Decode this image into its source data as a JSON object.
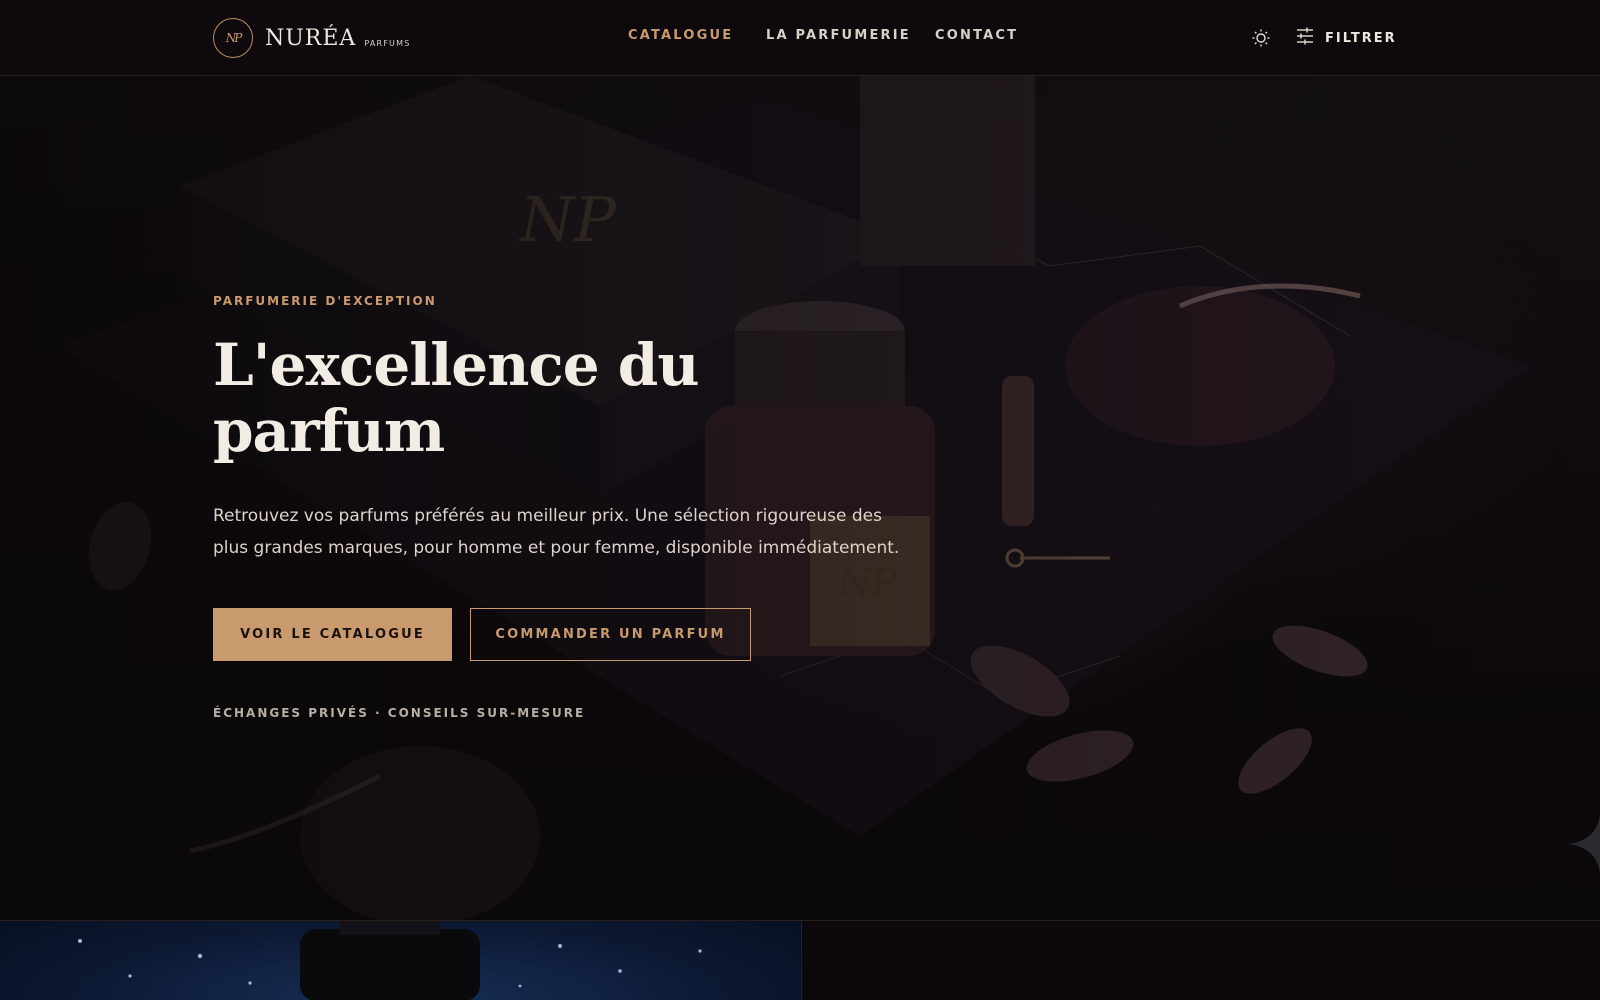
{
  "brand": {
    "monogram": "NP",
    "name": "NURÉA",
    "subtitle": "PARFUMS"
  },
  "nav": {
    "items": [
      {
        "label": "CATALOGUE",
        "active": true
      },
      {
        "label": "LA PARFUMERIE",
        "active": false
      },
      {
        "label": "CONTACT",
        "active": false
      }
    ]
  },
  "header": {
    "theme_icon": "sun-icon",
    "filter_icon": "sliders-icon",
    "filter_label": "FILTRER"
  },
  "hero": {
    "eyebrow": "PARFUMERIE D'EXCEPTION",
    "title": "L'excellence du parfum",
    "text": "Retrouvez vos parfums préférés au meilleur prix. Une sélection rigoureuse des plus grandes marques, pour homme et pour femme, disponible immédiatement.",
    "primary_button": "VOIR LE CATALOGUE",
    "secondary_button": "COMMANDER UN PARFUM",
    "tagline": "ÉCHANGES PRIVÉS · CONSEILS SUR-MESURE"
  },
  "colors": {
    "accent": "#c89a6e",
    "background": "#0c080b",
    "text": "#ece4dc"
  }
}
